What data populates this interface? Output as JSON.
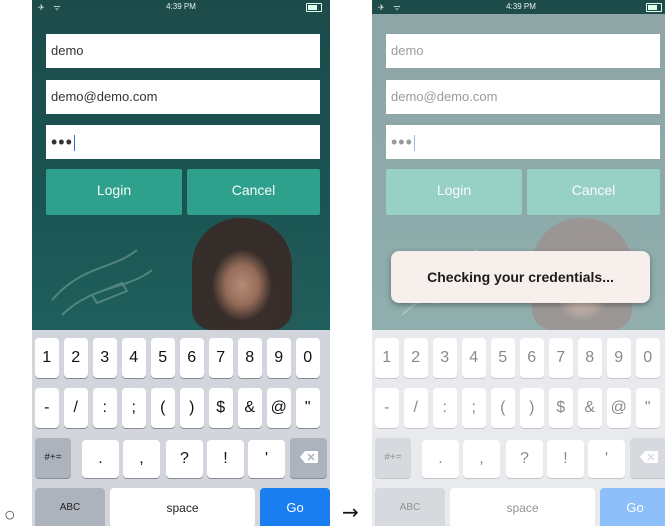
{
  "status": {
    "time": "4:39 PM",
    "left_icons": "✈ ᯤ"
  },
  "form": {
    "username_value": "demo",
    "email_value": "demo@demo.com",
    "password_value": "•••",
    "login_label": "Login",
    "cancel_label": "Cancel"
  },
  "keyboard": {
    "row1": [
      "1",
      "2",
      "3",
      "4",
      "5",
      "6",
      "7",
      "8",
      "9",
      "0"
    ],
    "row2": [
      "-",
      "/",
      ":",
      ";",
      "(",
      ")",
      "$",
      "&",
      "@",
      "\""
    ],
    "row3_toggle": "#+=",
    "row3": [
      ".",
      ",",
      "?",
      "!",
      "'"
    ],
    "delete_icon": "backspace-icon",
    "abc_label": "ABC",
    "space_label": "space",
    "go_label": "Go"
  },
  "toast": {
    "message": "Checking your credentials..."
  },
  "connector": {
    "bullet": "○",
    "arrow": "→"
  },
  "colors": {
    "accent_button": "#2fa08b",
    "go_key": "#1a7ef1",
    "background": "#1d4b4a"
  }
}
